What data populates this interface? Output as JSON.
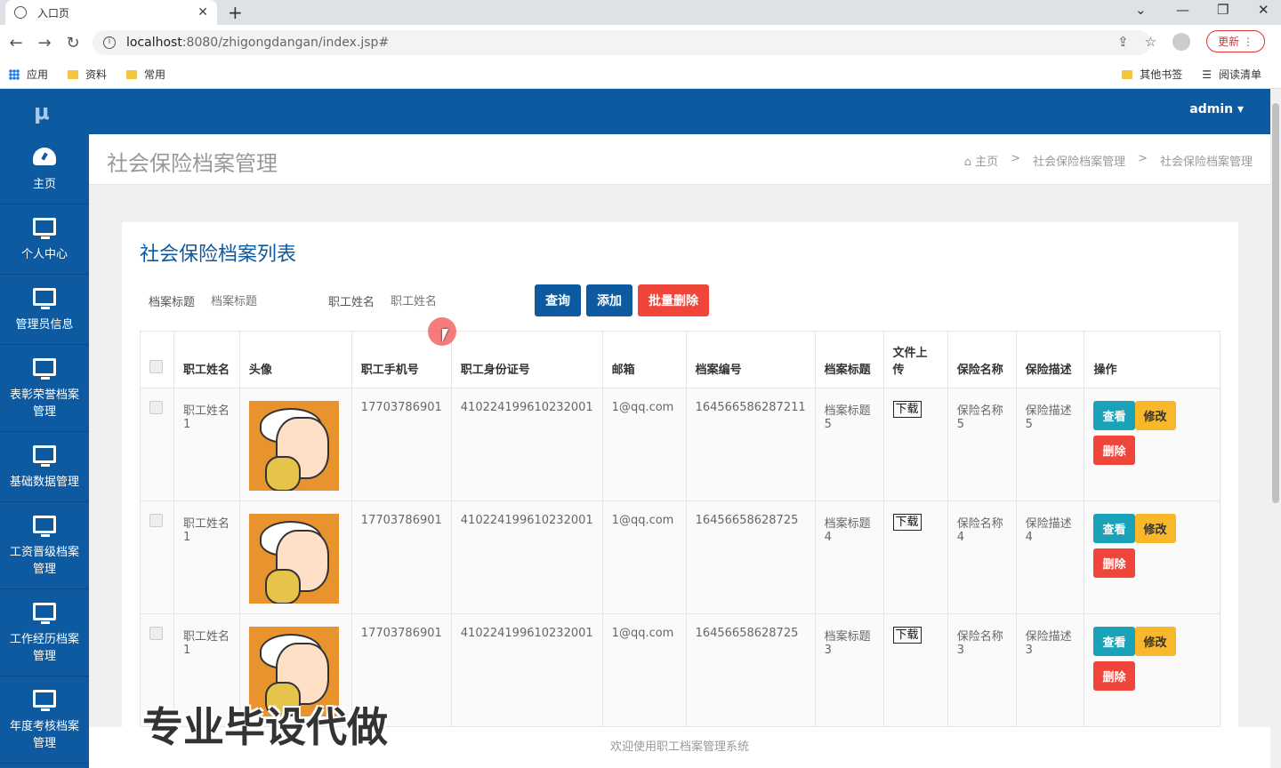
{
  "browser": {
    "tab_title": "入口页",
    "url_host": "localhost",
    "url_path": ":8080/zhigongdangan/index.jsp#",
    "update_label": "更新",
    "bookmarks": [
      "应用",
      "资料",
      "常用"
    ],
    "bookmarks_right": [
      "其他书签",
      "阅读清单"
    ]
  },
  "topnav": {
    "logo": "μ",
    "user": "admin ▾"
  },
  "sidebar": {
    "items": [
      {
        "label": "主页"
      },
      {
        "label": "个人中心"
      },
      {
        "label": "管理员信息"
      },
      {
        "label": "表彰荣誉档案管理"
      },
      {
        "label": "基础数据管理"
      },
      {
        "label": "工资晋级档案管理"
      },
      {
        "label": "工作经历档案管理"
      },
      {
        "label": "年度考核档案管理"
      }
    ]
  },
  "header": {
    "title": "社会保险档案管理",
    "breadcrumb": [
      "主页",
      ">",
      "社会保险档案管理",
      ">",
      "社会保险档案管理"
    ]
  },
  "card": {
    "title": "社会保险档案列表"
  },
  "search": {
    "label1": "档案标题",
    "placeholder1": "档案标题",
    "label2": "职工姓名",
    "placeholder2": "职工姓名",
    "query_label": "查询",
    "add_label": "添加",
    "batch_delete_label": "批量删除"
  },
  "table": {
    "headers": [
      "职工姓名",
      "头像",
      "职工手机号",
      "职工身份证号",
      "邮箱",
      "档案编号",
      "档案标题",
      "文件上传",
      "保险名称",
      "保险描述",
      "操作"
    ],
    "rows": [
      {
        "name": "职工姓名1",
        "phone": "17703786901",
        "id_card": "410224199610232001",
        "email": "1@qq.com",
        "archive_no": "164566586287211",
        "title": "档案标题5",
        "upload": "下载",
        "insurance_name": "保险名称5",
        "insurance_desc": "保险描述5"
      },
      {
        "name": "职工姓名1",
        "phone": "17703786901",
        "id_card": "410224199610232001",
        "email": "1@qq.com",
        "archive_no": "16456658628725",
        "title": "档案标题4",
        "upload": "下载",
        "insurance_name": "保险名称4",
        "insurance_desc": "保险描述4"
      },
      {
        "name": "职工姓名1",
        "phone": "17703786901",
        "id_card": "410224199610232001",
        "email": "1@qq.com",
        "archive_no": "16456658628725",
        "title": "档案标题3",
        "upload": "下载",
        "insurance_name": "保险名称3",
        "insurance_desc": "保险描述3"
      }
    ],
    "actions": {
      "view": "查看",
      "edit": "修改",
      "delete": "删除"
    }
  },
  "footer": {
    "text": "欢迎使用职工档案管理系统"
  },
  "watermark": "专业毕设代做"
}
